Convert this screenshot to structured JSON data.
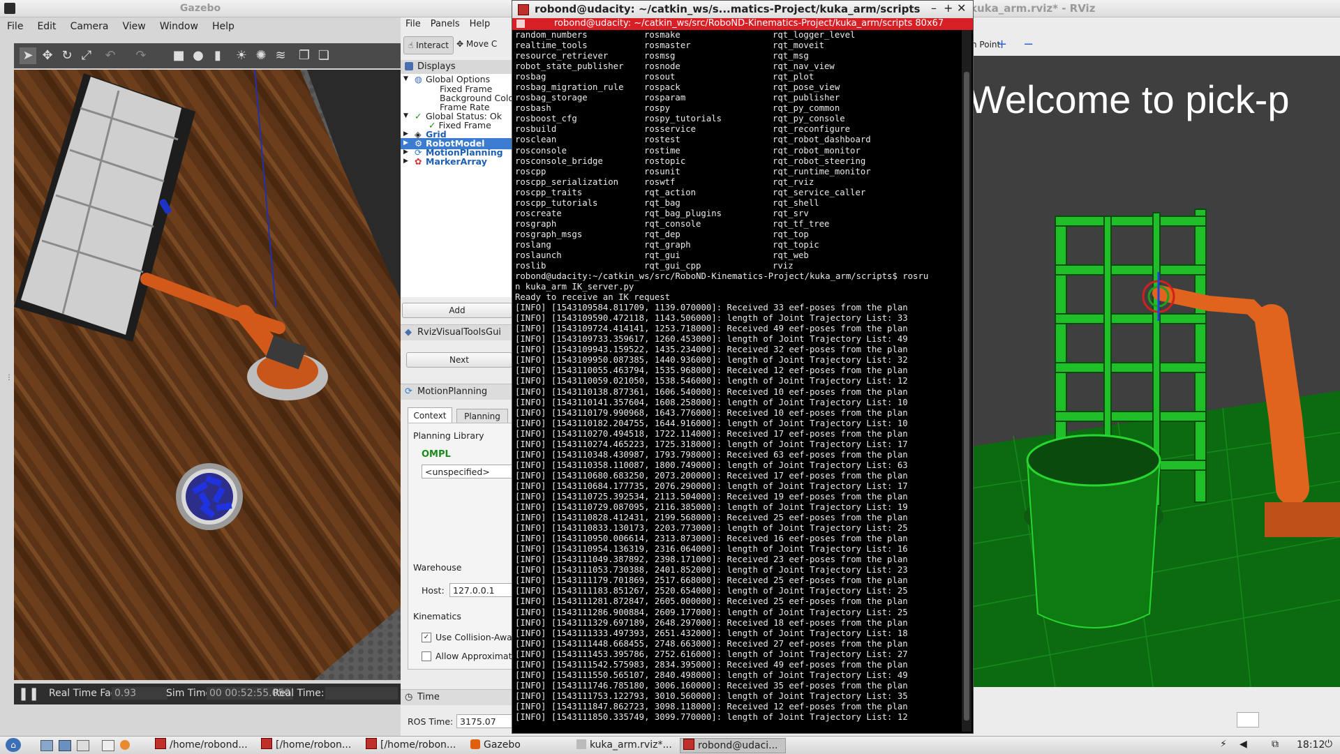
{
  "gazebo": {
    "title": "Gazebo",
    "menu": [
      "File",
      "Edit",
      "Camera",
      "View",
      "Window",
      "Help"
    ],
    "status": {
      "rtf_label": "Real Time Factor:",
      "rtf_value": "0.93",
      "sim_label": "Sim Time:",
      "sim_value": "00 00:52:55.050",
      "real_label": "Real Time:"
    }
  },
  "rviz": {
    "title": "kuka_arm.rviz* - RViz",
    "menu": [
      "File",
      "Panels",
      "Help"
    ],
    "toolbar": {
      "interact": "Interact",
      "move": "Move C",
      "point": "h Point"
    },
    "displays": {
      "header": "Displays",
      "items": [
        {
          "label": "Global Options"
        },
        {
          "label": "Fixed Frame"
        },
        {
          "label": "Background Color"
        },
        {
          "label": "Frame Rate"
        },
        {
          "label": "Global Status: Ok"
        },
        {
          "label": "Fixed Frame"
        },
        {
          "label": "Grid"
        },
        {
          "label": "RobotModel"
        },
        {
          "label": "MotionPlanning"
        },
        {
          "label": "MarkerArray"
        }
      ],
      "add_button": "Add"
    },
    "tools_gui": {
      "header": "RvizVisualToolsGui",
      "next_button": "Next"
    },
    "motion_planning": {
      "header": "MotionPlanning",
      "tabs": [
        "Context",
        "Planning"
      ],
      "planning_library_label": "Planning Library",
      "library": "OMPL",
      "planner": "<unspecified>",
      "warehouse_label": "Warehouse",
      "host_label": "Host:",
      "host_value": "127.0.0.1",
      "kinematics_label": "Kinematics",
      "use_collision_label": "Use Collision-Awar",
      "allow_approx_label": "Allow Approximate"
    },
    "time": {
      "header": "Time",
      "ros_time_label": "ROS Time:",
      "ros_time_value": "3175.07"
    },
    "view_text": "Welcome  to  pick-p"
  },
  "terminal": {
    "title": "robond@udacity: ~/catkin_ws/s...matics-Project/kuka_arm/scripts",
    "tab": "robond@udacity: ~/catkin_ws/src/RoboND-Kinematics-Project/kuka_arm/scripts 80x67",
    "col1": "random_numbers\nrealtime_tools\nresource_retriever\nrobot_state_publisher\nrosbag\nrosbag_migration_rule\nrosbag_storage\nrosbash\nrosboost_cfg\nrosbuild\nrosclean\nrosconsole\nrosconsole_bridge\nroscpp\nroscpp_serialization\nroscpp_traits\nroscpp_tutorials\nroscreate\nrosgraph\nrosgraph_msgs\nroslang\nroslaunch\nroslib",
    "col2": "rosmake\nrosmaster\nrosmsg\nrosnode\nrosout\nrospack\nrosparam\nrospy\nrospy_tutorials\nrosservice\nrostest\nrostime\nrostopic\nrosunit\nroswtf\nrqt_action\nrqt_bag\nrqt_bag_plugins\nrqt_console\nrqt_dep\nrqt_graph\nrqt_gui\nrqt_gui_cpp",
    "col3": "rqt_logger_level\nrqt_moveit\nrqt_msg\nrqt_nav_view\nrqt_plot\nrqt_pose_view\nrqt_publisher\nrqt_py_common\nrqt_py_console\nrqt_reconfigure\nrqt_robot_dashboard\nrqt_robot_monitor\nrqt_robot_steering\nrqt_runtime_monitor\nrqt_rviz\nrqt_service_caller\nrqt_shell\nrqt_srv\nrqt_tf_tree\nrqt_top\nrqt_topic\nrqt_web\nrviz",
    "log": "robond@udacity:~/catkin_ws/src/RoboND-Kinematics-Project/kuka_arm/scripts$ rosru\nn kuka_arm IK_server.py\nReady to receive an IK request\n[INFO] [1543109584.811709, 1139.070000]: Received 33 eef-poses from the plan\n[INFO] [1543109590.472118, 1143.506000]: length of Joint Trajectory List: 33\n[INFO] [1543109724.414141, 1253.718000]: Received 49 eef-poses from the plan\n[INFO] [1543109733.359617, 1260.453000]: length of Joint Trajectory List: 49\n[INFO] [1543109943.159522, 1435.234000]: Received 32 eef-poses from the plan\n[INFO] [1543109950.087385, 1440.936000]: length of Joint Trajectory List: 32\n[INFO] [1543110055.463794, 1535.968000]: Received 12 eef-poses from the plan\n[INFO] [1543110059.021050, 1538.546000]: length of Joint Trajectory List: 12\n[INFO] [1543110138.877361, 1606.540000]: Received 10 eef-poses from the plan\n[INFO] [1543110141.357604, 1608.258000]: length of Joint Trajectory List: 10\n[INFO] [1543110179.990968, 1643.776000]: Received 10 eef-poses from the plan\n[INFO] [1543110182.204755, 1644.916000]: length of Joint Trajectory List: 10\n[INFO] [1543110270.494518, 1722.114000]: Received 17 eef-poses from the plan\n[INFO] [1543110274.465223, 1725.318000]: length of Joint Trajectory List: 17\n[INFO] [1543110348.430987, 1793.798000]: Received 63 eef-poses from the plan\n[INFO] [1543110358.110087, 1800.749000]: length of Joint Trajectory List: 63\n[INFO] [1543110680.683250, 2073.200000]: Received 17 eef-poses from the plan\n[INFO] [1543110684.177735, 2076.290000]: length of Joint Trajectory List: 17\n[INFO] [1543110725.392534, 2113.504000]: Received 19 eef-poses from the plan\n[INFO] [1543110729.087095, 2116.385000]: length of Joint Trajectory List: 19\n[INFO] [1543110828.412431, 2199.568000]: Received 25 eef-poses from the plan\n[INFO] [1543110833.130173, 2203.773000]: length of Joint Trajectory List: 25\n[INFO] [1543110950.006614, 2313.873000]: Received 16 eef-poses from the plan\n[INFO] [1543110954.136319, 2316.064000]: length of Joint Trajectory List: 16\n[INFO] [1543111049.387892, 2398.171000]: Received 23 eef-poses from the plan\n[INFO] [1543111053.730388, 2401.852000]: length of Joint Trajectory List: 23\n[INFO] [1543111179.701869, 2517.668000]: Received 25 eef-poses from the plan\n[INFO] [1543111183.851267, 2520.654000]: length of Joint Trajectory List: 25\n[INFO] [1543111281.872847, 2605.000000]: Received 25 eef-poses from the plan\n[INFO] [1543111286.900884, 2609.177000]: length of Joint Trajectory List: 25\n[INFO] [1543111329.697189, 2648.297000]: Received 18 eef-poses from the plan\n[INFO] [1543111333.497393, 2651.432000]: length of Joint Trajectory List: 18\n[INFO] [1543111448.668455, 2748.663000]: Received 27 eef-poses from the plan\n[INFO] [1543111453.395786, 2752.616000]: length of Joint Trajectory List: 27\n[INFO] [1543111542.575983, 2834.395000]: Received 49 eef-poses from the plan\n[INFO] [1543111550.565107, 2840.498000]: length of Joint Trajectory List: 49\n[INFO] [1543111746.785180, 3006.160000]: Received 35 eef-poses from the plan\n[INFO] [1543111753.122793, 3010.560000]: length of Joint Trajectory List: 35\n[INFO] [1543111847.862723, 3098.118000]: Received 12 eef-poses from the plan\n[INFO] [1543111850.335749, 3099.770000]: length of Joint Trajectory List: 12"
  },
  "taskbar": {
    "tasks": [
      "/home/robond...",
      "[/home/robon...",
      "[/home/robon...",
      "Gazebo",
      "kuka_arm.rviz*...",
      "robond@udaci..."
    ],
    "clock": "18:12"
  },
  "colors": {
    "terminal_tab": "#d81f26",
    "selection": "#3c7cd0",
    "robot_orange": "#e0641e",
    "shelf_green": "#1fbf2a"
  }
}
